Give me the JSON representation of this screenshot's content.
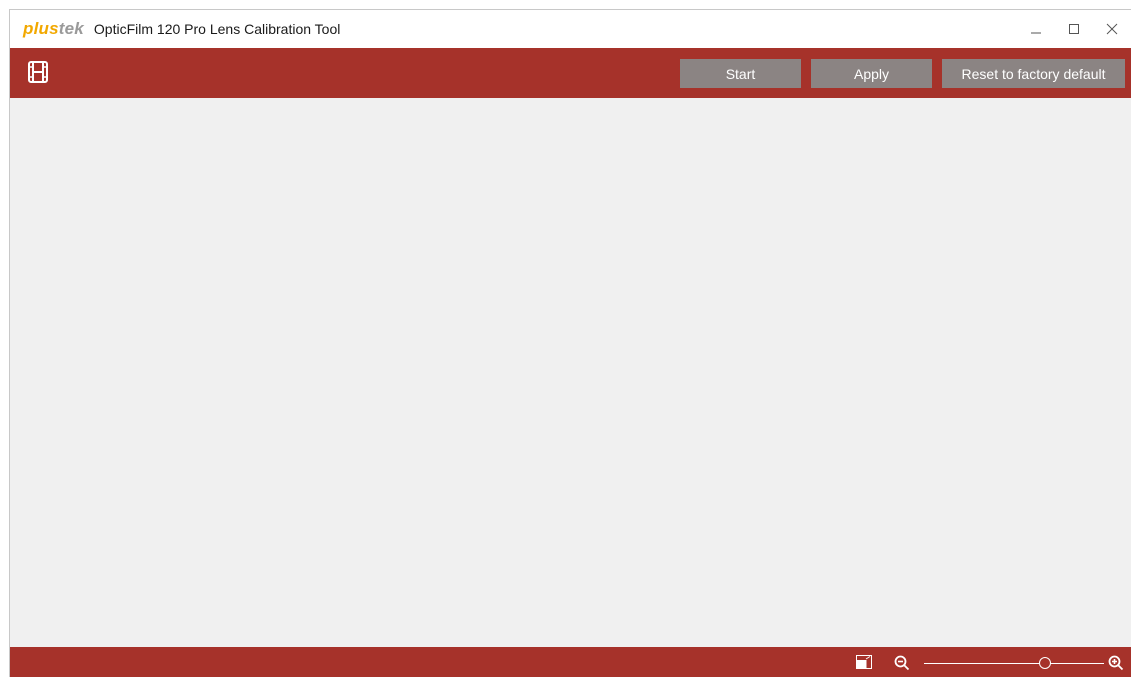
{
  "window": {
    "logo_main": "plus",
    "logo_accent": "tek",
    "title": "OpticFilm 120 Pro Lens Calibration Tool",
    "controls": [
      "minimize-icon",
      "maximize-icon",
      "close-icon"
    ]
  },
  "toolbar": {
    "film_icon": "film-icon",
    "start_label": "Start",
    "apply_label": "Apply",
    "reset_label": "Reset to factory default"
  },
  "statusbar": {
    "fit_icon": "fit-to-window-icon",
    "zoom_out_icon": "zoom-out-icon",
    "zoom_in_icon": "zoom-in-icon",
    "zoom_level_fraction": 0.67
  },
  "colors": {
    "brand_red": "#a6322a",
    "button_gray": "#8b8483",
    "content_bg": "#f0f0f0",
    "logo_orange": "#f2a800"
  }
}
